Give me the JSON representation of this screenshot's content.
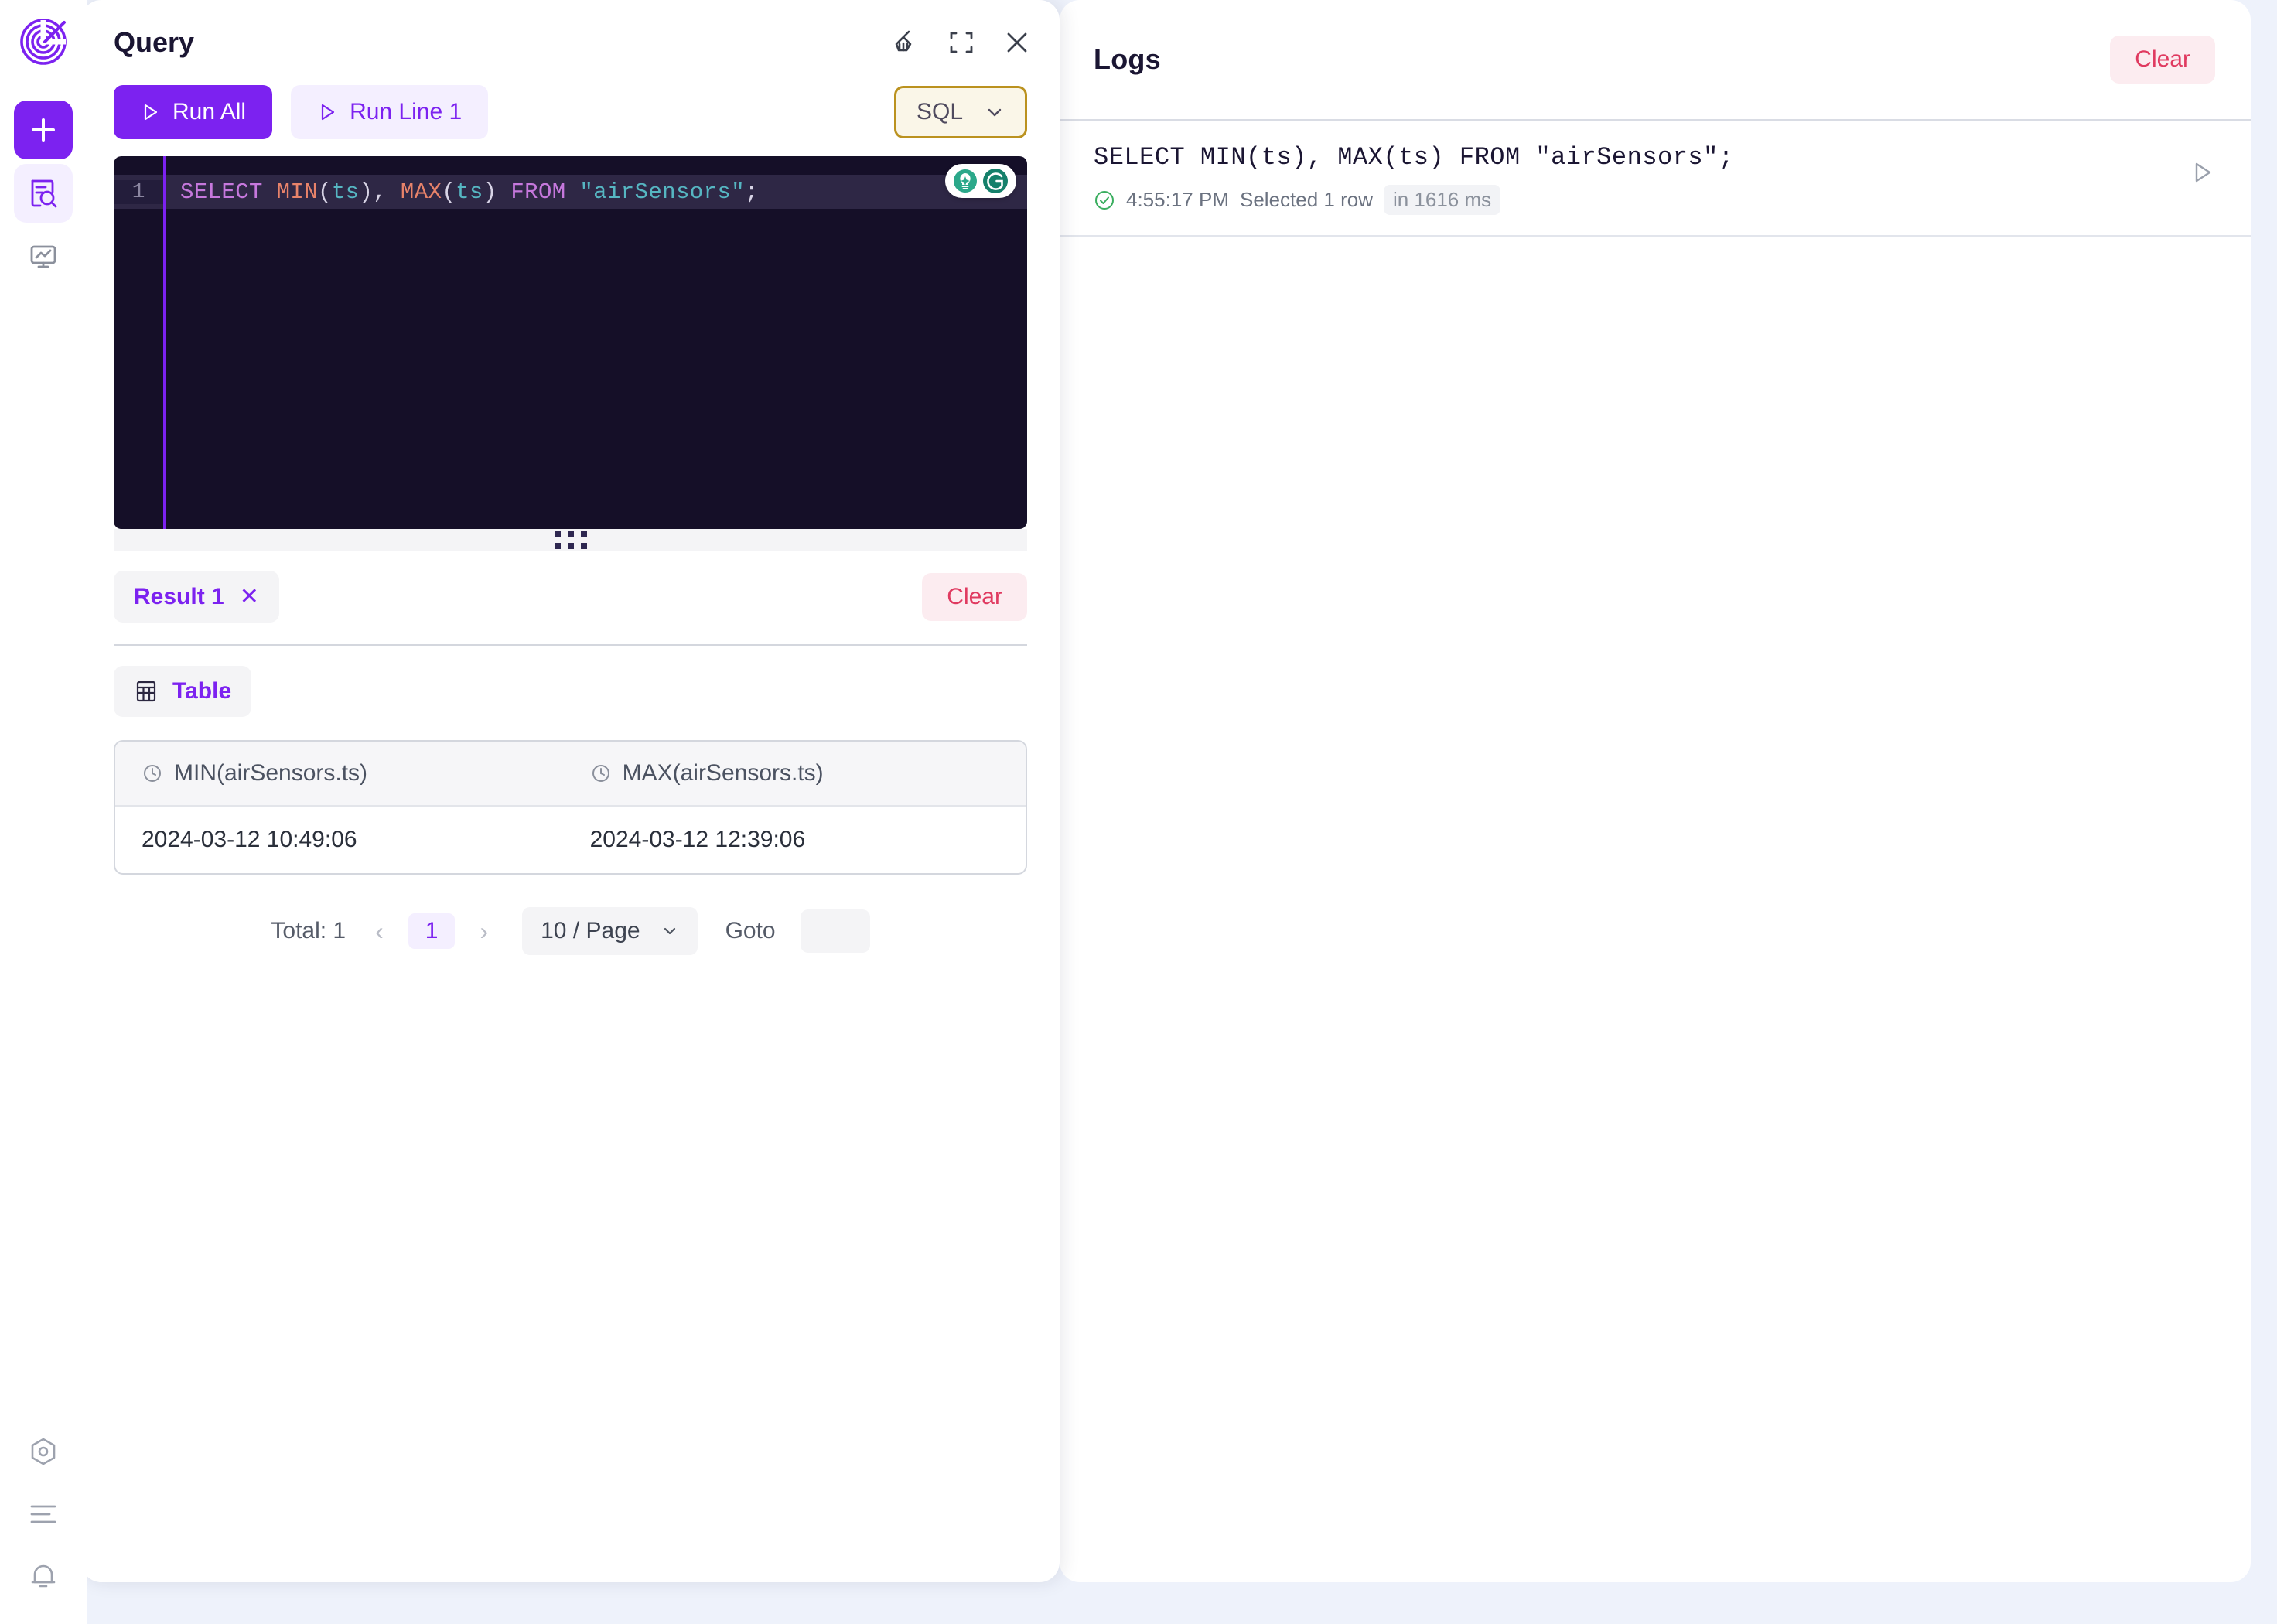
{
  "app": {
    "logo_icon": "spiral-target-logo"
  },
  "sidebar": {
    "items": [
      {
        "name": "add-button",
        "icon": "plus-icon",
        "state": "primary"
      },
      {
        "name": "query-button",
        "icon": "document-search-icon",
        "state": "active"
      },
      {
        "name": "dashboard-button",
        "icon": "monitor-chart-icon",
        "state": "default"
      }
    ],
    "bottom_items": [
      {
        "name": "settings-button",
        "icon": "hex-gear-icon"
      },
      {
        "name": "menu-button",
        "icon": "list-lines-icon"
      },
      {
        "name": "notifications-button",
        "icon": "bell-icon"
      }
    ]
  },
  "query_panel": {
    "title": "Query",
    "header_icons": [
      {
        "name": "format-broom-icon",
        "icon": "broom-icon"
      },
      {
        "name": "fullscreen-icon",
        "icon": "expand-icon"
      },
      {
        "name": "close-icon",
        "icon": "x-icon"
      }
    ],
    "toolbar": {
      "run_all_label": "Run All",
      "run_line_label": "Run Line 1",
      "language_value": "SQL",
      "language_chevron": "chevron-down-icon"
    },
    "editor": {
      "line_number": "1",
      "assist_icons": [
        "lightbulb-icon",
        "grammarly-g-icon"
      ],
      "tokens": [
        {
          "t": "SELECT ",
          "c": "kw"
        },
        {
          "t": "MIN",
          "c": "fn"
        },
        {
          "t": "(",
          "c": "p"
        },
        {
          "t": "ts",
          "c": "col"
        },
        {
          "t": ")",
          "c": "p"
        },
        {
          "t": ", ",
          "c": "p"
        },
        {
          "t": "MAX",
          "c": "fn"
        },
        {
          "t": "(",
          "c": "p"
        },
        {
          "t": "ts",
          "c": "col"
        },
        {
          "t": ")",
          "c": "p"
        },
        {
          "t": " FROM ",
          "c": "kw"
        },
        {
          "t": "\"airSensors\"",
          "c": "str"
        },
        {
          "t": ";",
          "c": "p"
        }
      ],
      "plain_text": "SELECT MIN(ts), MAX(ts) FROM \"airSensors\";"
    },
    "results": {
      "tab_label": "Result 1",
      "tab_close": "✕",
      "clear_label": "Clear",
      "view_tab_label": "Table",
      "view_tab_icon": "table-grid-icon",
      "columns": [
        {
          "label": "MIN(airSensors.ts)",
          "icon": "clock-icon"
        },
        {
          "label": "MAX(airSensors.ts)",
          "icon": "clock-icon"
        }
      ],
      "rows": [
        [
          "2024-03-12 10:49:06",
          "2024-03-12 12:39:06"
        ]
      ],
      "pagination": {
        "total_label": "Total: 1",
        "prev_icon": "‹",
        "next_icon": "›",
        "current_page": "1",
        "page_size_label": "10 / Page",
        "page_size_chevron": "chevron-down-icon",
        "goto_label": "Goto",
        "goto_value": "",
        "goto_placeholder": ""
      }
    }
  },
  "logs_panel": {
    "title": "Logs",
    "clear_label": "Clear",
    "entries": [
      {
        "sql": "SELECT MIN(ts), MAX(ts) FROM \"airSensors\";",
        "status_icon": "check-circle-icon",
        "time": "4:55:17 PM",
        "result_text": "Selected 1 row",
        "duration": "in 1616 ms",
        "rerun_icon": "play-icon"
      }
    ]
  },
  "colors": {
    "accent": "#7c22f0",
    "accent_soft": "#f4efff",
    "danger": "#e03a60",
    "danger_soft": "#fcecf0",
    "gold": "#bb921f",
    "gold_soft": "#faf6e8",
    "success": "#3aae5f",
    "editor_bg": "#150f28",
    "page_bg": "#eef2fb"
  }
}
